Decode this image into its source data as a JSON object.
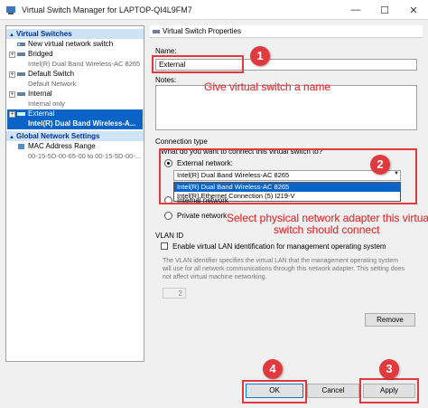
{
  "window": {
    "title": "Virtual Switch Manager for LAPTOP-QI4L9FM7",
    "minimize": "—",
    "maximize": "☐",
    "close": "✕"
  },
  "tree": {
    "virtual_switches_header": "Virtual Switches",
    "new_switch": "New virtual network switch",
    "switches": [
      {
        "name": "Bridged",
        "sub": "Intel(R) Dual Band Wireless-AC 8265"
      },
      {
        "name": "Default Switch",
        "sub": "Default Network"
      },
      {
        "name": "Internal",
        "sub": "Internal only"
      },
      {
        "name": "External",
        "sub": "Intel(R) Dual Band Wireless-A..."
      }
    ],
    "global_header": "Global Network Settings",
    "mac_range": {
      "name": "MAC Address Range",
      "sub": "00-15-5D-00-65-00 to 00-15-5D-00-..."
    }
  },
  "props": {
    "header": "Virtual Switch Properties",
    "name_label": "Name:",
    "name_value": "External",
    "notes_label": "Notes:",
    "connection_type_label": "Connection type",
    "connection_question": "What do you want to connect this virtual switch to?",
    "external_label": "External network:",
    "adapter_selected": "Intel(R) Dual Band Wireless-AC 8265",
    "adapter_options": [
      "Intel(R) Dual Band Wireless-AC 8265",
      "Intel(R) Ethernet Connection (5) I219-V"
    ],
    "internal_label": "Internal network",
    "private_label": "Private network",
    "vlan_header": "VLAN ID",
    "vlan_checkbox_label": "Enable virtual LAN identification for management operating system",
    "vlan_description": "The VLAN identifier specifies the virtual LAN that the management operating system will use for all network communications through this network adapter. This setting does not affect virtual machine networking.",
    "vlan_value": "2",
    "remove_button": "Remove"
  },
  "buttons": {
    "ok": "OK",
    "cancel": "Cancel",
    "apply": "Apply"
  },
  "annotations": {
    "step1": "1",
    "step2": "2",
    "step3": "3",
    "step4": "4",
    "text1": "Give virtual switch a name",
    "text2_line1": "Select physical network adapter this virtual",
    "text2_line2": "switch should connect"
  },
  "colors": {
    "annotation": "#e0393e",
    "selection": "#0a64c8",
    "tree_header": "#cfe3f7"
  }
}
